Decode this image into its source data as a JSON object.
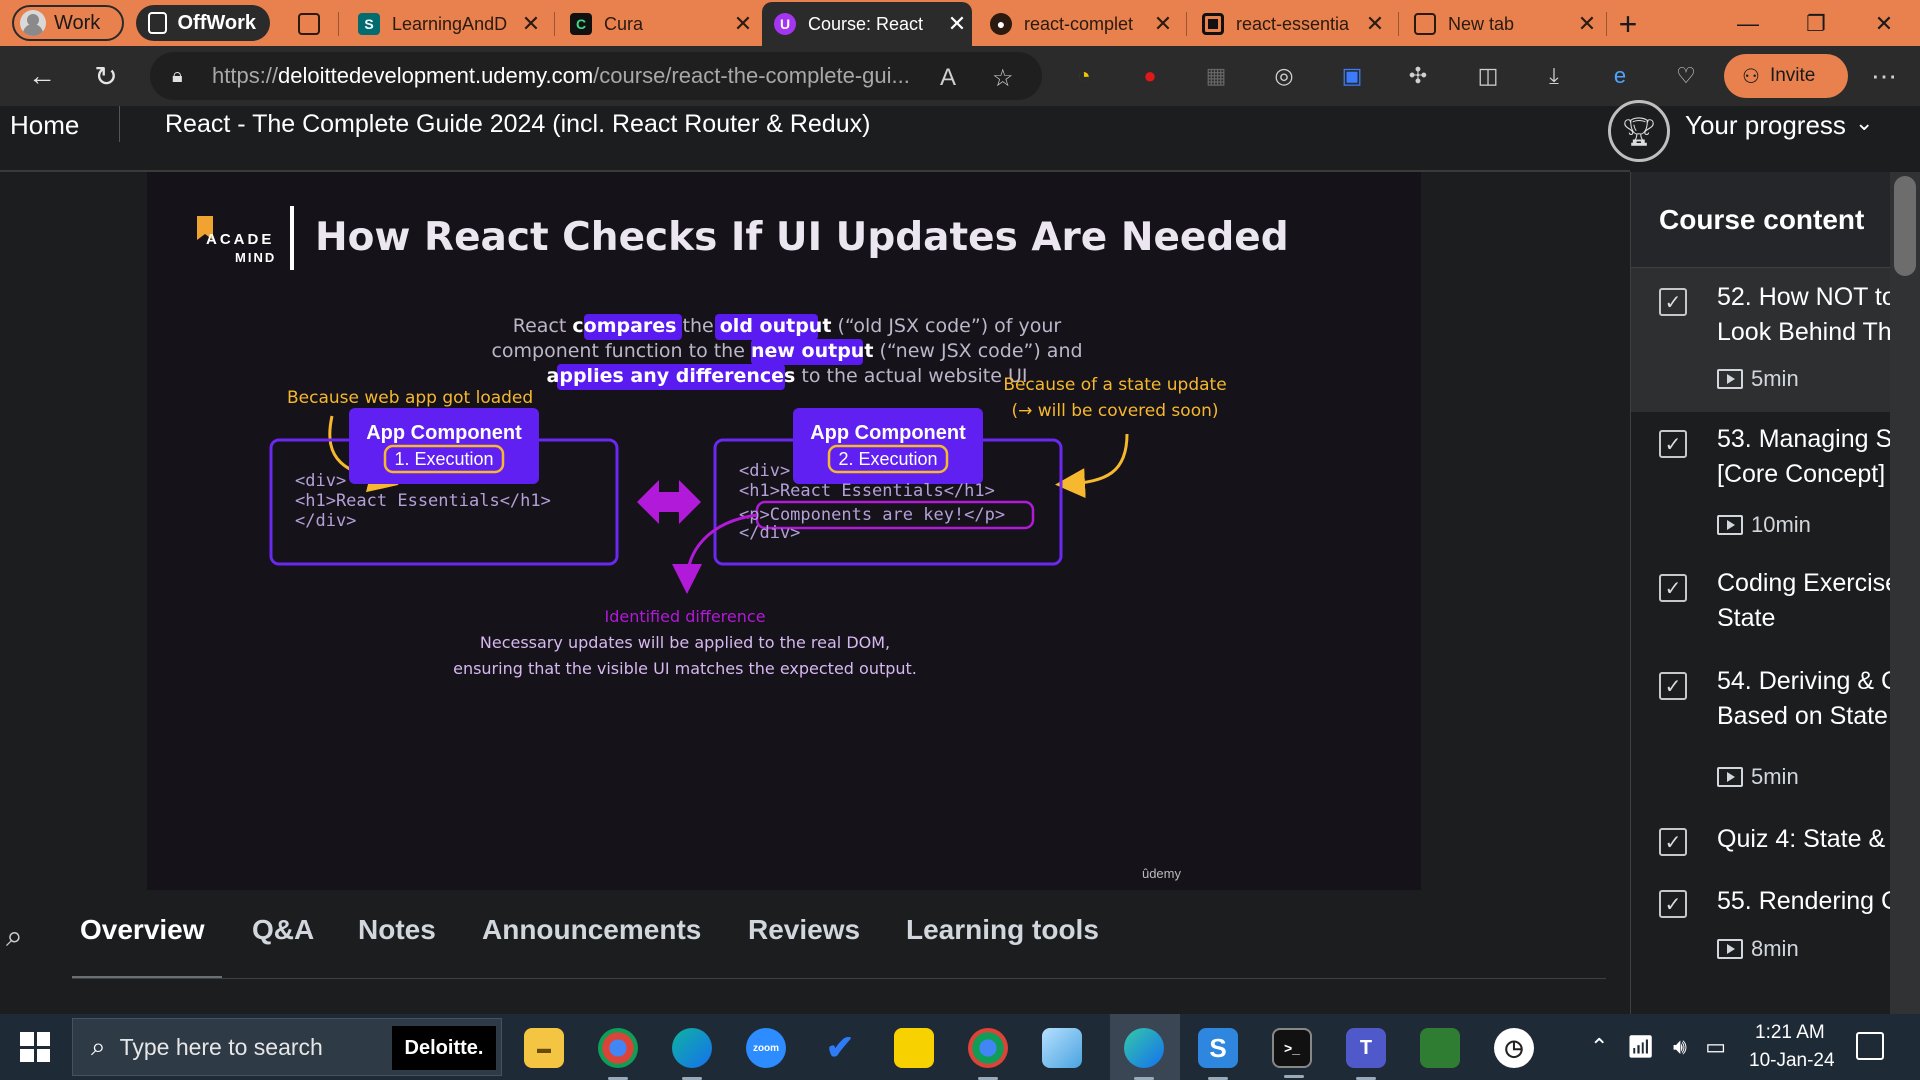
{
  "browser": {
    "profiles": {
      "work": "Work",
      "offwork": "OffWork"
    },
    "tabs": [
      {
        "title": "LearningAndD",
        "icon": "sharepoint-icon"
      },
      {
        "title": "Cura",
        "icon": "cura-icon"
      },
      {
        "title": "Course: React",
        "icon": "udemy-icon",
        "active": true
      },
      {
        "title": "react-complet",
        "icon": "github-icon"
      },
      {
        "title": "react-essentia",
        "icon": "codesandbox-icon"
      },
      {
        "title": "New tab",
        "icon": "new-tab-icon"
      }
    ],
    "url_host": "deloittedevelopment.udemy.com",
    "url_scheme": "https://",
    "url_path": "/course/react-the-complete-gui...",
    "invite_label": "Invite"
  },
  "course_header": {
    "home": "Home",
    "title": "React - The Complete Guide 2024 (incl. React Router & Redux)",
    "progress": "Your progress"
  },
  "slide": {
    "logo_top": "ACADE",
    "logo_bottom": "MIND",
    "title": "How React Checks If UI Updates Are Needed",
    "intro_line1_a": "React ",
    "intro_compares": "compares",
    "intro_line1_b": " the ",
    "intro_old_output": "old output",
    "intro_line1_c": " (“old JSX code”) of your",
    "intro_line2_a": "component function to the ",
    "intro_new_output": "new output",
    "intro_line2_b": " (“new JSX code”) and",
    "intro_applies": "applies any differences",
    "intro_line3_b": " to the actual website UI",
    "left_note": "Because web app got loaded",
    "right_note_1": "Because of a state update",
    "right_note_2": "(→ will be covered soon)",
    "left_component": "App Component",
    "left_exec": "1. Execution",
    "right_component": "App Component",
    "right_exec": "2. Execution",
    "left_code": [
      "<div>",
      "  <h1>React Essentials</h1>",
      "</div>"
    ],
    "right_code": [
      "<div>",
      "  <h1>React Essentials</h1>",
      "  <p>Components are key!</p>",
      "</div>"
    ],
    "diff_label": "Identified difference",
    "diff_line1": "Necessary updates will be applied to the real DOM,",
    "diff_line2": "ensuring that the visible UI matches the expected output.",
    "watermark": "ûdemy"
  },
  "content_tabs": [
    "Overview",
    "Q&A",
    "Notes",
    "Announcements",
    "Reviews",
    "Learning tools"
  ],
  "sidebar": {
    "title": "Course content",
    "lectures": [
      {
        "line1": "52. How NOT to",
        "line2": "Look Behind Th",
        "duration": "5min",
        "active": true
      },
      {
        "line1": "53. Managing S",
        "line2": "[Core Concept]",
        "duration": "10min"
      },
      {
        "line1": "Coding Exercise",
        "line2": "State",
        "duration": ""
      },
      {
        "line1": "54. Deriving & C",
        "line2": "Based on State",
        "duration": "5min"
      },
      {
        "line1": "Quiz 4: State & (",
        "line2": "",
        "duration": ""
      },
      {
        "line1": "55. Rendering C",
        "line2": "",
        "duration": "8min"
      }
    ]
  },
  "taskbar": {
    "search_placeholder": "Type here to search",
    "deloitte": "Deloitte.",
    "time": "1:21 AM",
    "date": "10-Jan-24"
  }
}
